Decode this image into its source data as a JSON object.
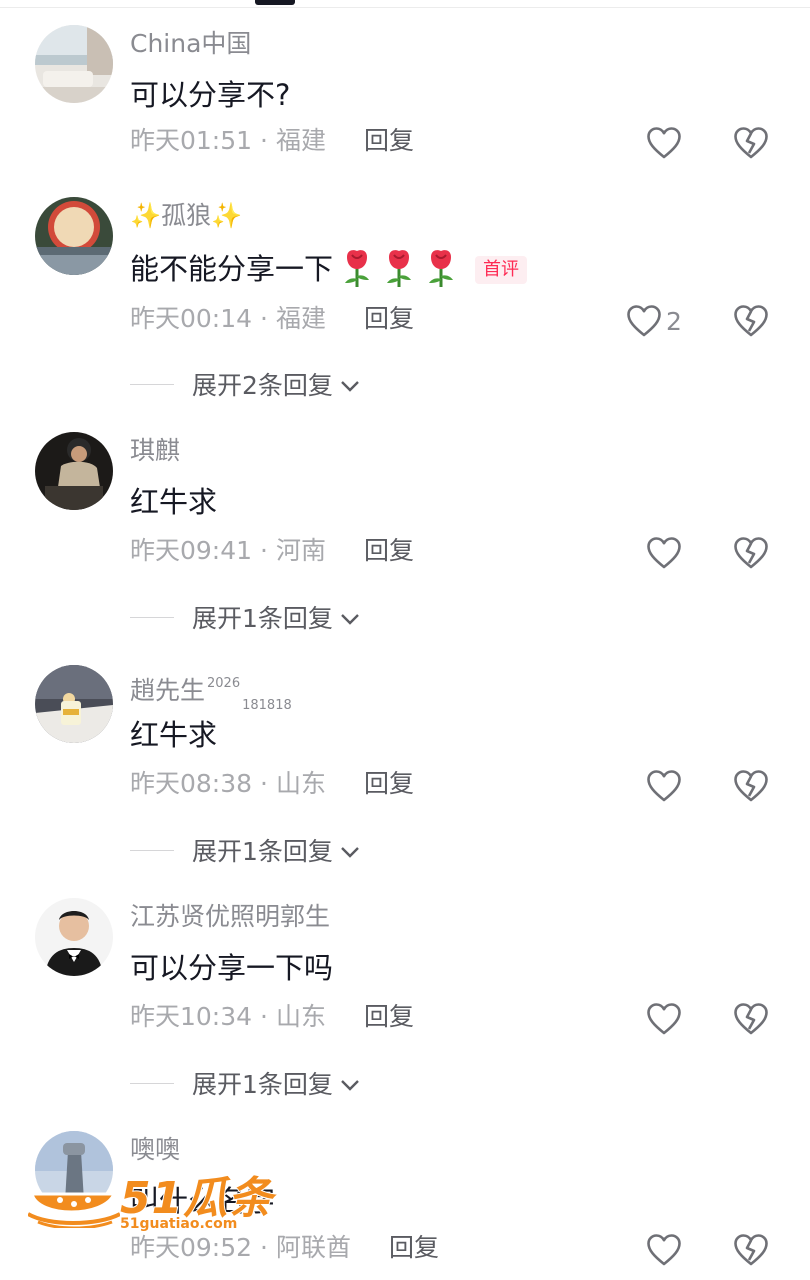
{
  "comments": [
    {
      "username": "China中国",
      "content": "可以分享不?",
      "time": "昨天01:51",
      "location": "福建",
      "reply_label": "回复"
    },
    {
      "username": "✨孤狼✨",
      "content": "能不能分享一下",
      "first_tag": "首评",
      "time": "昨天00:14",
      "location": "福建",
      "reply_label": "回复",
      "likes": "2",
      "expand": "展开2条回复"
    },
    {
      "username": "琪麒",
      "content": "红牛求",
      "time": "昨天09:41",
      "location": "河南",
      "reply_label": "回复",
      "expand": "展开1条回复"
    },
    {
      "username": "趙先生",
      "badge_sup": "2026",
      "badge_sub": "181818",
      "content": "红牛求",
      "time": "昨天08:38",
      "location": "山东",
      "reply_label": "回复",
      "expand": "展开1条回复"
    },
    {
      "username": "江苏贤优照明郭生",
      "content": "可以分享一下吗",
      "time": "昨天10:34",
      "location": "山东",
      "reply_label": "回复",
      "expand": "展开1条回复"
    },
    {
      "username": "噢噢",
      "content": "叫什么名字",
      "time": "昨天09:52",
      "location": "阿联酋",
      "reply_label": "回复"
    }
  ],
  "separator": "·",
  "watermark": {
    "logo_text": "51瓜条",
    "url": "51guatiao.com"
  },
  "icons": {
    "like": "heart-outline-icon",
    "dislike": "broken-heart-icon",
    "expand": "chevron-down-icon",
    "emoji": "rose-emoji"
  },
  "colors": {
    "username": "#8a8b91",
    "meta": "#a8a9ad",
    "first_tag": "#fe2c55",
    "watermark": "#f28c1e"
  }
}
